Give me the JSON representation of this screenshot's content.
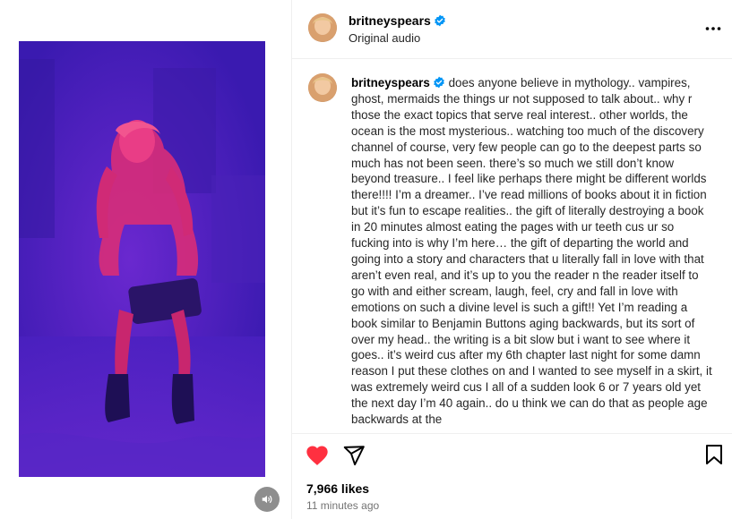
{
  "colors": {
    "like_red": "#ff3040",
    "verified_blue": "#0095f6",
    "media_background": "#4a22c4",
    "figure_pink": "#e0317a"
  },
  "icons": {
    "audio": "speaker-icon",
    "more": "more-horizontal-icon",
    "like": "heart-filled-icon",
    "share": "paper-plane-icon",
    "save": "bookmark-icon",
    "verified": "verified-badge-icon"
  },
  "header": {
    "username": "britneyspears",
    "subtitle": "Original audio"
  },
  "caption": {
    "username": "britneyspears",
    "text": "does anyone believe in mythology.. vampires, ghost, mermaids the things ur not supposed to talk about.. why r those the exact topics that serve real interest.. other worlds, the ocean is the most mysterious.. watching too much of the discovery channel of course, very few people can go to the deepest parts so much has not been seen. there’s so much we still don’t know beyond treasure.. I feel like perhaps there might be different worlds there!!!! I’m a dreamer.. I’ve read millions of books about it in fiction but it’s fun to escape realities.. the gift of literally destroying a book in 20 minutes almost eating the pages with ur teeth cus ur so fucking into is why I’m here… the gift of departing the world and going into a story and characters that u literally fall in love with that aren’t even real, and it’s up to you the reader n the reader itself to go with and either scream, laugh, feel, cry and fall in love with emotions on such a divine level is such a gift!! Yet I’m reading a book similar to Benjamin Buttons aging backwards, but its sort of over my head.. the writing is a bit slow but i want to see where it goes.. it’s weird cus after my 6th chapter last night for some damn reason I put these clothes on and I wanted to see myself in a skirt, it was extremely weird cus I all of a sudden look 6 or 7 years old yet the next day I’m 40 again.. do u think we can do that as people age backwards at the"
  },
  "stats": {
    "likes": "7,966 likes",
    "time": "11 minutes ago"
  }
}
